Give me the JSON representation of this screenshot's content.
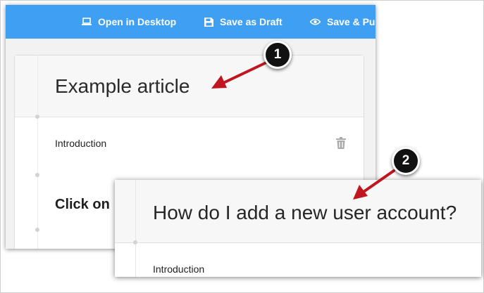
{
  "toolbar": {
    "open_desktop_label": "Open in Desktop",
    "save_draft_label": "Save as Draft",
    "save_publish_label": "Save & Pu",
    "icons": [
      "laptop-icon",
      "floppy-disk-icon",
      "eye-icon"
    ],
    "background_color": "#3fa0f3"
  },
  "editor1": {
    "title": "Example article",
    "intro_label": "Introduction",
    "section_heading": "Click on",
    "delete_icon": "trash-icon"
  },
  "editor2": {
    "title": "How do I add a new user account?",
    "intro_label": "Introduction"
  },
  "annotations": {
    "marker1": "1",
    "marker2": "2",
    "arrow_color": "#c0161f"
  }
}
